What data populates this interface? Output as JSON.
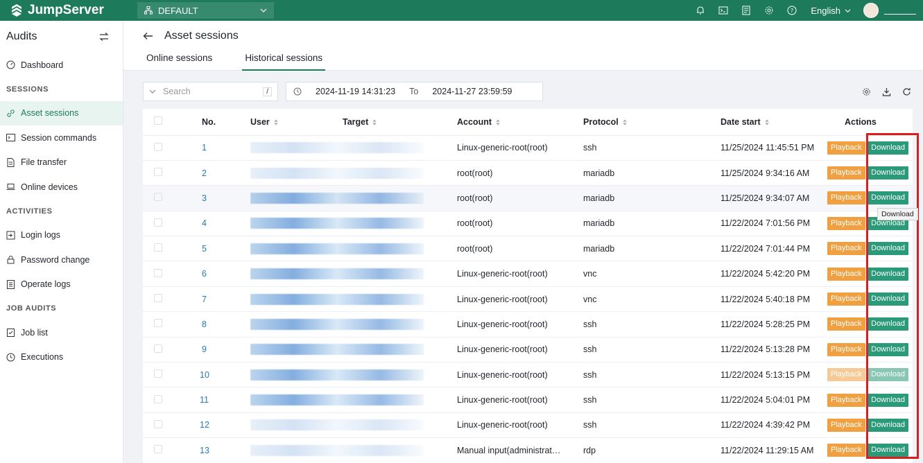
{
  "topbar": {
    "brand": "JumpServer",
    "org": "DEFAULT",
    "language": "English",
    "icons": [
      "bell-icon",
      "terminal-icon",
      "tickets-icon",
      "gear-icon",
      "help-icon"
    ]
  },
  "sidebar": {
    "title": "Audits",
    "items": [
      {
        "label": "Dashboard",
        "icon": "dashboard-icon"
      },
      {
        "section": "SESSIONS"
      },
      {
        "label": "Asset sessions",
        "icon": "link-icon",
        "active": true
      },
      {
        "label": "Session commands",
        "icon": "terminal-icon"
      },
      {
        "label": "File transfer",
        "icon": "file-icon"
      },
      {
        "label": "Online devices",
        "icon": "laptop-icon"
      },
      {
        "section": "ACTIVITIES"
      },
      {
        "label": "Login logs",
        "icon": "login-icon"
      },
      {
        "label": "Password change",
        "icon": "lock-icon"
      },
      {
        "label": "Operate logs",
        "icon": "list-icon"
      },
      {
        "section": "JOB AUDITS"
      },
      {
        "label": "Job list",
        "icon": "clipboard-icon"
      },
      {
        "label": "Executions",
        "icon": "history-icon"
      }
    ]
  },
  "page": {
    "title": "Asset sessions",
    "tabs": [
      {
        "label": "Online sessions"
      },
      {
        "label": "Historical sessions",
        "active": true
      }
    ]
  },
  "toolbar": {
    "search_placeholder": "Search",
    "shortcut": "/",
    "date_from": "2024-11-19 14:31:23",
    "date_to_label": "To",
    "date_to": "2024-11-27 23:59:59"
  },
  "table": {
    "headers": {
      "no": "No.",
      "user": "User",
      "target": "Target",
      "account": "Account",
      "protocol": "Protocol",
      "date_start": "Date start",
      "actions": "Actions"
    },
    "playback_label": "Playback",
    "download_label": "Download",
    "rows": [
      {
        "no": "1",
        "account": "Linux-generic-root(root)",
        "protocol": "ssh",
        "date": "11/25/2024 11:45:51 PM"
      },
      {
        "no": "2",
        "account": "root(root)",
        "protocol": "mariadb",
        "date": "11/25/2024 9:34:16 AM"
      },
      {
        "no": "3",
        "account": "root(root)",
        "protocol": "mariadb",
        "date": "11/25/2024 9:34:07 AM"
      },
      {
        "no": "4",
        "account": "root(root)",
        "protocol": "mariadb",
        "date": "11/22/2024 7:01:56 PM"
      },
      {
        "no": "5",
        "account": "root(root)",
        "protocol": "mariadb",
        "date": "11/22/2024 7:01:44 PM"
      },
      {
        "no": "6",
        "account": "Linux-generic-root(root)",
        "protocol": "vnc",
        "date": "11/22/2024 5:42:20 PM"
      },
      {
        "no": "7",
        "account": "Linux-generic-root(root)",
        "protocol": "vnc",
        "date": "11/22/2024 5:40:18 PM"
      },
      {
        "no": "8",
        "account": "Linux-generic-root(root)",
        "protocol": "ssh",
        "date": "11/22/2024 5:28:25 PM"
      },
      {
        "no": "9",
        "account": "Linux-generic-root(root)",
        "protocol": "ssh",
        "date": "11/22/2024 5:13:28 PM"
      },
      {
        "no": "10",
        "account": "Linux-generic-root(root)",
        "protocol": "ssh",
        "date": "11/22/2024 5:13:15 PM"
      },
      {
        "no": "11",
        "account": "Linux-generic-root(root)",
        "protocol": "ssh",
        "date": "11/22/2024 5:04:01 PM"
      },
      {
        "no": "12",
        "account": "Linux-generic-root(root)",
        "protocol": "ssh",
        "date": "11/22/2024 4:39:42 PM"
      },
      {
        "no": "13",
        "account": "Manual input(administrat…",
        "protocol": "rdp",
        "date": "11/22/2024 11:29:15 AM"
      }
    ]
  },
  "tooltip": "Download",
  "colors": {
    "brand": "#1d7a5b",
    "playback": "#f0a041",
    "download": "#2a9a78",
    "highlight": "#e01b1b"
  }
}
